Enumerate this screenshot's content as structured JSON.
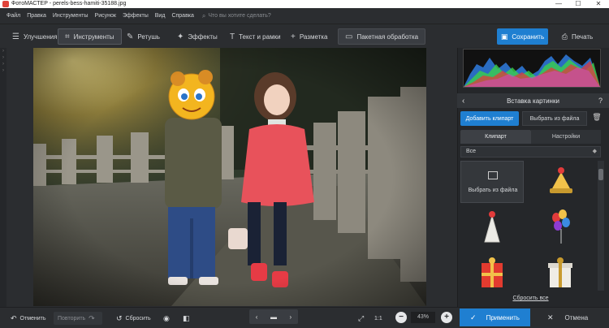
{
  "window": {
    "title": "ФотоМАСТЕР - perels-bess-hamiti-35188.jpg",
    "minimize": "—",
    "maximize": "☐",
    "close": "✕"
  },
  "menu": {
    "items": [
      "Файл",
      "Правка",
      "Инструменты",
      "Рисунок",
      "Эффекты",
      "Вид",
      "Справка"
    ],
    "search_placeholder": "Что вы хотите сделать?",
    "search_icon": "search-icon"
  },
  "toolbar": {
    "items": [
      {
        "label": "Улучшения",
        "icon": "sliders-icon",
        "glyph": "☰",
        "active": false
      },
      {
        "label": "Инструменты",
        "icon": "crop-icon",
        "glyph": "⌗",
        "active": true
      },
      {
        "label": "Ретушь",
        "icon": "brush-icon",
        "glyph": "✎",
        "active": false
      },
      {
        "label": "Эффекты",
        "icon": "magic-wand-icon",
        "glyph": "✦",
        "active": false
      },
      {
        "label": "Текст и рамки",
        "icon": "text-icon",
        "glyph": "T",
        "active": false
      },
      {
        "label": "Разметка",
        "icon": "plus-icon",
        "glyph": "+",
        "active": false
      },
      {
        "label": "Пакетная обработка",
        "icon": "batch-icon",
        "glyph": "▭",
        "active": false
      }
    ],
    "save_label": "Сохранить",
    "print_label": "Печать"
  },
  "panel": {
    "title": "Вставка картинки",
    "help": "?",
    "add_clipart_label": "Добавить клипарт",
    "from_file_label": "Выбрать из файла",
    "tabs": [
      {
        "label": "Клипарт",
        "active": true
      },
      {
        "label": "Настройки",
        "active": false
      }
    ],
    "category_value": "Все",
    "choose_file_tile_label": "Выбрать из файла",
    "clipart_items": [
      {
        "icon": "party-horn-icon"
      },
      {
        "icon": "party-hat-icon"
      },
      {
        "icon": "balloons-icon"
      },
      {
        "icon": "gift-box-red-icon"
      },
      {
        "icon": "gift-box-white-icon"
      }
    ],
    "reset_all_label": "Сбросить все"
  },
  "bottombar": {
    "undo_label": "Отменить",
    "redo_label": "Повторить",
    "reset_label": "Сбросить",
    "zoom_actual_label": "1:1",
    "zoom_value": "43%",
    "apply_label": "Применить",
    "cancel_label": "Отмена"
  },
  "colors": {
    "accent": "#1f7fd1",
    "background": "#2b2d30",
    "panel": "#25272a"
  }
}
